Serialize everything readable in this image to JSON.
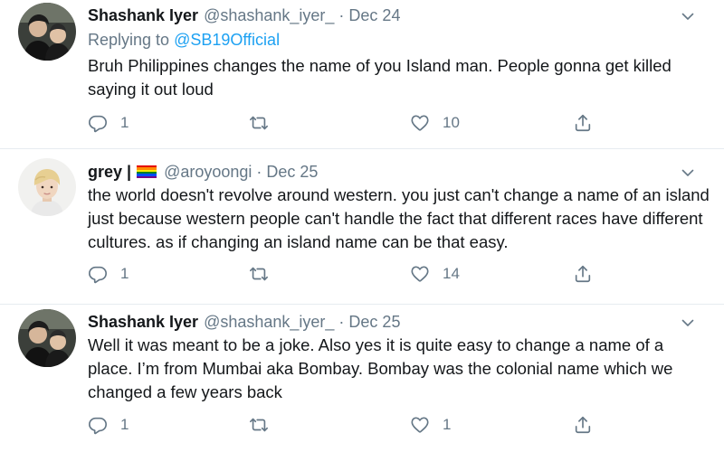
{
  "tweets": [
    {
      "display_name": "Shashank Iyer",
      "handle": "@shashank_iyer_",
      "separator": "·",
      "date": "Dec 24",
      "replying_prefix": "Replying to",
      "replying_to": "@SB19Official",
      "text": "Bruh Philippines changes the name of you Island man. People gonna get killed saying it out loud",
      "actions": {
        "reply_count": "1",
        "retweet_count": "",
        "like_count": "10"
      },
      "avatar_icon": "two-men-photo-avatar"
    },
    {
      "display_name": "grey |",
      "handle": "@aroyoongi",
      "separator": "·",
      "date": "Dec 25",
      "name_icon": "rainbow-flag-icon",
      "text": "the world doesn't revolve around western. you just can't change a name of an island just because western people can't handle the fact that different races have different cultures. as if changing an island name can be that easy.",
      "actions": {
        "reply_count": "1",
        "retweet_count": "",
        "like_count": "14"
      },
      "avatar_icon": "blond-person-avatar"
    },
    {
      "display_name": "Shashank Iyer",
      "handle": "@shashank_iyer_",
      "separator": "·",
      "date": "Dec 25",
      "text": "Well it was meant to be a joke. Also yes it is quite easy to change a name of a place. I’m from Mumbai aka Bombay. Bombay was the colonial name which we changed a few years back",
      "actions": {
        "reply_count": "1",
        "retweet_count": "",
        "like_count": "1"
      },
      "avatar_icon": "two-men-photo-avatar"
    }
  ],
  "colors": {
    "text": "#14171a",
    "secondary": "#657786",
    "link": "#1da1f2",
    "divider": "#e6ecf0"
  },
  "icons": [
    "reply-icon",
    "retweet-icon",
    "like-icon",
    "share-icon",
    "chevron-down-icon"
  ]
}
